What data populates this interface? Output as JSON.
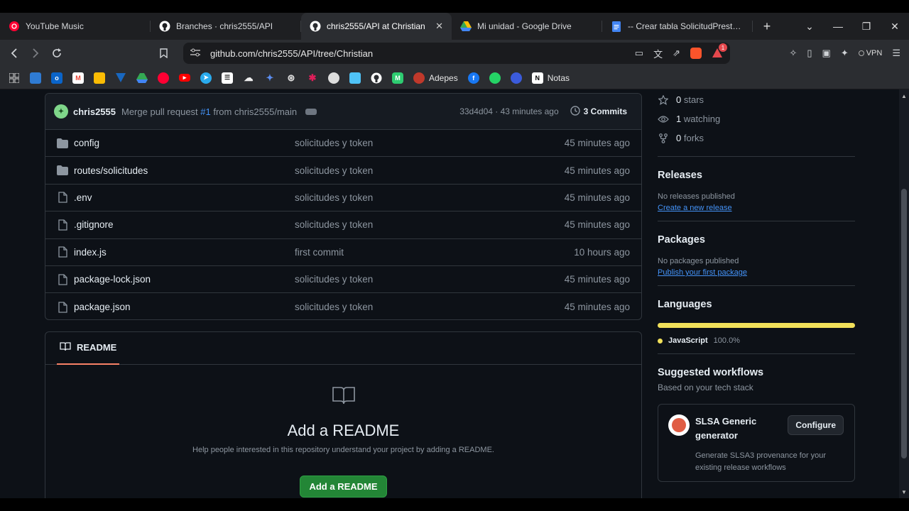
{
  "browser": {
    "tabs": [
      {
        "title": "YouTube Music",
        "icon": "youtube-music-icon",
        "active": false
      },
      {
        "title": "Branches · chris2555/API",
        "icon": "github-icon",
        "active": false
      },
      {
        "title": "chris2555/API at Christian",
        "icon": "github-icon",
        "active": true
      },
      {
        "title": "Mi unidad - Google Drive",
        "icon": "google-drive-icon",
        "active": false
      },
      {
        "title": "-- Crear tabla SolicitudPrestamo",
        "icon": "google-docs-icon",
        "active": false
      }
    ],
    "url": "github.com/chris2555/API/tree/Christian",
    "rewards_badge": "1",
    "vpn_label": "VPN",
    "bookmarks": [
      {
        "icon": "apps-grid-icon",
        "label": ""
      },
      {
        "icon": "bookmark-1-icon",
        "label": ""
      },
      {
        "icon": "outlook-icon",
        "label": ""
      },
      {
        "icon": "gmail-icon",
        "label": ""
      },
      {
        "icon": "keep-icon",
        "label": ""
      },
      {
        "icon": "vuetify-icon",
        "label": ""
      },
      {
        "icon": "drive-icon",
        "label": ""
      },
      {
        "icon": "music-icon",
        "label": ""
      },
      {
        "icon": "youtube-icon",
        "label": ""
      },
      {
        "icon": "telegram-icon",
        "label": ""
      },
      {
        "icon": "bookmark-2-icon",
        "label": ""
      },
      {
        "icon": "weather-icon",
        "label": ""
      },
      {
        "icon": "gemini-icon",
        "label": ""
      },
      {
        "icon": "chatgpt-icon",
        "label": ""
      },
      {
        "icon": "slack-icon",
        "label": ""
      },
      {
        "icon": "bookmark-3-icon",
        "label": ""
      },
      {
        "icon": "bookmark-4-icon",
        "label": ""
      },
      {
        "icon": "github-icon",
        "label": ""
      },
      {
        "icon": "bookmark-5-icon",
        "label": ""
      },
      {
        "icon": "adepes-icon",
        "label": "Adepes"
      },
      {
        "icon": "facebook-icon",
        "label": ""
      },
      {
        "icon": "whatsapp-icon",
        "label": ""
      },
      {
        "icon": "bookmark-6-icon",
        "label": ""
      },
      {
        "icon": "notion-icon",
        "label": "Notas"
      }
    ]
  },
  "repo": {
    "commit": {
      "author": "chris2555",
      "message_prefix": "Merge pull request ",
      "pr_link": "#1",
      "message_suffix": " from chris2555/main",
      "meta": "33d4d04 · 43 minutes ago",
      "commits_label": "3 Commits"
    },
    "files": [
      {
        "type": "folder",
        "name": "config",
        "message": "solicitudes y token",
        "date": "45 minutes ago"
      },
      {
        "type": "folder",
        "name": "routes/solicitudes",
        "message": "solicitudes y token",
        "date": "45 minutes ago"
      },
      {
        "type": "file",
        "name": ".env",
        "message": "solicitudes y token",
        "date": "45 minutes ago"
      },
      {
        "type": "file",
        "name": ".gitignore",
        "message": "solicitudes y token",
        "date": "45 minutes ago"
      },
      {
        "type": "file",
        "name": "index.js",
        "message": "first commit",
        "date": "10 hours ago"
      },
      {
        "type": "file",
        "name": "package-lock.json",
        "message": "solicitudes y token",
        "date": "45 minutes ago"
      },
      {
        "type": "file",
        "name": "package.json",
        "message": "solicitudes y token",
        "date": "45 minutes ago"
      }
    ],
    "readme": {
      "tab_label": "README",
      "heading": "Add a README",
      "help": "Help people interested in this repository understand your project by adding a README.",
      "button": "Add a README"
    }
  },
  "sidebar": {
    "stars": {
      "num": "0",
      "label": "stars"
    },
    "watching": {
      "num": "1",
      "label": "watching"
    },
    "forks": {
      "num": "0",
      "label": "forks"
    },
    "releases": {
      "title": "Releases",
      "empty": "No releases published",
      "link": "Create a new release"
    },
    "packages": {
      "title": "Packages",
      "empty": "No packages published",
      "link": "Publish your first package"
    },
    "languages": {
      "title": "Languages",
      "items": [
        {
          "name": "JavaScript",
          "percent": "100.0%",
          "color": "#f1e05a"
        }
      ]
    },
    "workflows": {
      "title": "Suggested workflows",
      "subtitle": "Based on your tech stack",
      "card": {
        "title": "SLSA Generic generator",
        "description": "Generate SLSA3 provenance for your existing release workflows",
        "button": "Configure"
      }
    }
  }
}
